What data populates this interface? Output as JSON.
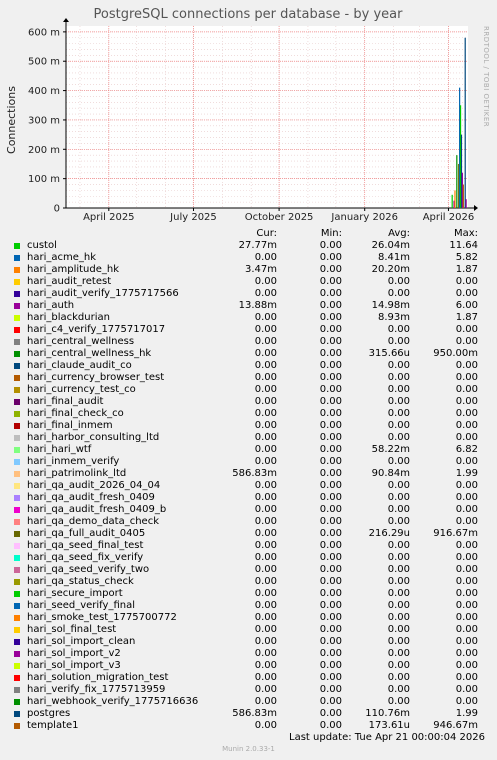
{
  "chart_data": {
    "type": "line",
    "title": "PostgreSQL connections per database - by year",
    "ylabel": "Connections",
    "watermark": "RRDTOOL / TOBI OETIKER",
    "ylim": [
      0,
      620
    ],
    "yticks": [
      {
        "v": 0,
        "label": "0"
      },
      {
        "v": 100,
        "label": "100 m"
      },
      {
        "v": 200,
        "label": "200 m"
      },
      {
        "v": 300,
        "label": "300 m"
      },
      {
        "v": 400,
        "label": "400 m"
      },
      {
        "v": 500,
        "label": "500 m"
      },
      {
        "v": 600,
        "label": "600 m"
      }
    ],
    "xrange": [
      "2025-02-14",
      "2026-04-22"
    ],
    "xticks": [
      {
        "date": "2025-04-01",
        "label": "April 2025"
      },
      {
        "date": "2025-07-01",
        "label": "July 2025"
      },
      {
        "date": "2025-10-01",
        "label": "October 2025"
      },
      {
        "date": "2026-01-01",
        "label": "January 2026"
      },
      {
        "date": "2026-04-01",
        "label": "April 2026"
      }
    ],
    "minor_gridlines": [
      "2025-03-01",
      "2025-04-01",
      "2025-05-01",
      "2025-06-01",
      "2025-07-01",
      "2025-08-01",
      "2025-09-01",
      "2025-10-01",
      "2025-11-01",
      "2025-12-01",
      "2026-01-01",
      "2026-02-01",
      "2026-03-01",
      "2026-04-01"
    ],
    "spikes": [
      {
        "series": "custol",
        "date": "2026-04-05",
        "value": 45
      },
      {
        "series": "hari_auth",
        "date": "2026-04-07",
        "value": 25
      },
      {
        "series": "hari_amplitude_hk",
        "date": "2026-04-08",
        "value": 60
      },
      {
        "series": "hari_central_wellness_hk",
        "date": "2026-04-10",
        "value": 180
      },
      {
        "series": "hari_qa_full_audit_0405",
        "date": "2026-04-12",
        "value": 150
      },
      {
        "series": "hari_acme_hk",
        "date": "2026-04-13",
        "value": 410
      },
      {
        "series": "custol",
        "date": "2026-04-14",
        "value": 350
      },
      {
        "series": "postgres",
        "date": "2026-04-15",
        "value": 250
      },
      {
        "series": "hari_auth",
        "date": "2026-04-16",
        "value": 120
      },
      {
        "series": "template1",
        "date": "2026-04-17",
        "value": 80
      },
      {
        "series": "postgres",
        "date": "2026-04-19",
        "value": 580
      },
      {
        "series": "hari_sol_import_v2",
        "date": "2026-04-20",
        "value": 30
      }
    ],
    "legend_headers": {
      "cur": "Cur:",
      "min": "Min:",
      "avg": "Avg:",
      "max": "Max:"
    },
    "series": [
      {
        "name": "custol",
        "color": "#00cc00",
        "cur": "27.77m",
        "min": "0.00",
        "avg": "26.04m",
        "max": "11.64"
      },
      {
        "name": "hari_acme_hk",
        "color": "#0066b3",
        "cur": "0.00",
        "min": "0.00",
        "avg": "8.41m",
        "max": "5.82"
      },
      {
        "name": "hari_amplitude_hk",
        "color": "#ff8000",
        "cur": "3.47m",
        "min": "0.00",
        "avg": "20.20m",
        "max": "1.87"
      },
      {
        "name": "hari_audit_retest",
        "color": "#ffcc00",
        "cur": "0.00",
        "min": "0.00",
        "avg": "0.00",
        "max": "0.00"
      },
      {
        "name": "hari_audit_verify_1775717566",
        "color": "#330099",
        "cur": "0.00",
        "min": "0.00",
        "avg": "0.00",
        "max": "0.00"
      },
      {
        "name": "hari_auth",
        "color": "#990099",
        "cur": "13.88m",
        "min": "0.00",
        "avg": "14.98m",
        "max": "6.00"
      },
      {
        "name": "hari_blackdurian",
        "color": "#ccff00",
        "cur": "0.00",
        "min": "0.00",
        "avg": "8.93m",
        "max": "1.87"
      },
      {
        "name": "hari_c4_verify_1775717017",
        "color": "#ff0000",
        "cur": "0.00",
        "min": "0.00",
        "avg": "0.00",
        "max": "0.00"
      },
      {
        "name": "hari_central_wellness",
        "color": "#808080",
        "cur": "0.00",
        "min": "0.00",
        "avg": "0.00",
        "max": "0.00"
      },
      {
        "name": "hari_central_wellness_hk",
        "color": "#008f00",
        "cur": "0.00",
        "min": "0.00",
        "avg": "315.66u",
        "max": "950.00m"
      },
      {
        "name": "hari_claude_audit_co",
        "color": "#00487d",
        "cur": "0.00",
        "min": "0.00",
        "avg": "0.00",
        "max": "0.00"
      },
      {
        "name": "hari_currency_browser_test",
        "color": "#b35a00",
        "cur": "0.00",
        "min": "0.00",
        "avg": "0.00",
        "max": "0.00"
      },
      {
        "name": "hari_currency_test_co",
        "color": "#b38f00",
        "cur": "0.00",
        "min": "0.00",
        "avg": "0.00",
        "max": "0.00"
      },
      {
        "name": "hari_final_audit",
        "color": "#6b006b",
        "cur": "0.00",
        "min": "0.00",
        "avg": "0.00",
        "max": "0.00"
      },
      {
        "name": "hari_final_check_co",
        "color": "#8fb300",
        "cur": "0.00",
        "min": "0.00",
        "avg": "0.00",
        "max": "0.00"
      },
      {
        "name": "hari_final_inmem",
        "color": "#b30000",
        "cur": "0.00",
        "min": "0.00",
        "avg": "0.00",
        "max": "0.00"
      },
      {
        "name": "hari_harbor_consulting_ltd",
        "color": "#bebebe",
        "cur": "0.00",
        "min": "0.00",
        "avg": "0.00",
        "max": "0.00"
      },
      {
        "name": "hari_hari_wtf",
        "color": "#80ff80",
        "cur": "0.00",
        "min": "0.00",
        "avg": "58.22m",
        "max": "6.82"
      },
      {
        "name": "hari_inmem_verify",
        "color": "#80c9ff",
        "cur": "0.00",
        "min": "0.00",
        "avg": "0.00",
        "max": "0.00"
      },
      {
        "name": "hari_patrimolink_ltd",
        "color": "#ffc080",
        "cur": "586.83m",
        "min": "0.00",
        "avg": "90.84m",
        "max": "1.99"
      },
      {
        "name": "hari_qa_audit_2026_04_04",
        "color": "#ffe680",
        "cur": "0.00",
        "min": "0.00",
        "avg": "0.00",
        "max": "0.00"
      },
      {
        "name": "hari_qa_audit_fresh_0409",
        "color": "#aa80ff",
        "cur": "0.00",
        "min": "0.00",
        "avg": "0.00",
        "max": "0.00"
      },
      {
        "name": "hari_qa_audit_fresh_0409_b",
        "color": "#ee00cc",
        "cur": "0.00",
        "min": "0.00",
        "avg": "0.00",
        "max": "0.00"
      },
      {
        "name": "hari_qa_demo_data_check",
        "color": "#ff8080",
        "cur": "0.00",
        "min": "0.00",
        "avg": "0.00",
        "max": "0.00"
      },
      {
        "name": "hari_qa_full_audit_0405",
        "color": "#666600",
        "cur": "0.00",
        "min": "0.00",
        "avg": "216.29u",
        "max": "916.67m"
      },
      {
        "name": "hari_qa_seed_final_test",
        "color": "#ffbfff",
        "cur": "0.00",
        "min": "0.00",
        "avg": "0.00",
        "max": "0.00"
      },
      {
        "name": "hari_qa_seed_fix_verify",
        "color": "#00ffcc",
        "cur": "0.00",
        "min": "0.00",
        "avg": "0.00",
        "max": "0.00"
      },
      {
        "name": "hari_qa_seed_verify_two",
        "color": "#cc6699",
        "cur": "0.00",
        "min": "0.00",
        "avg": "0.00",
        "max": "0.00"
      },
      {
        "name": "hari_qa_status_check",
        "color": "#999900",
        "cur": "0.00",
        "min": "0.00",
        "avg": "0.00",
        "max": "0.00"
      },
      {
        "name": "hari_secure_import",
        "color": "#00cc00",
        "cur": "0.00",
        "min": "0.00",
        "avg": "0.00",
        "max": "0.00"
      },
      {
        "name": "hari_seed_verify_final",
        "color": "#0066b3",
        "cur": "0.00",
        "min": "0.00",
        "avg": "0.00",
        "max": "0.00"
      },
      {
        "name": "hari_smoke_test_1775700772",
        "color": "#ff8000",
        "cur": "0.00",
        "min": "0.00",
        "avg": "0.00",
        "max": "0.00"
      },
      {
        "name": "hari_sol_final_test",
        "color": "#ffcc00",
        "cur": "0.00",
        "min": "0.00",
        "avg": "0.00",
        "max": "0.00"
      },
      {
        "name": "hari_sol_import_clean",
        "color": "#330099",
        "cur": "0.00",
        "min": "0.00",
        "avg": "0.00",
        "max": "0.00"
      },
      {
        "name": "hari_sol_import_v2",
        "color": "#990099",
        "cur": "0.00",
        "min": "0.00",
        "avg": "0.00",
        "max": "0.00"
      },
      {
        "name": "hari_sol_import_v3",
        "color": "#ccff00",
        "cur": "0.00",
        "min": "0.00",
        "avg": "0.00",
        "max": "0.00"
      },
      {
        "name": "hari_solution_migration_test",
        "color": "#ff0000",
        "cur": "0.00",
        "min": "0.00",
        "avg": "0.00",
        "max": "0.00"
      },
      {
        "name": "hari_verify_fix_1775713959",
        "color": "#808080",
        "cur": "0.00",
        "min": "0.00",
        "avg": "0.00",
        "max": "0.00"
      },
      {
        "name": "hari_webhook_verify_1775716636",
        "color": "#008f00",
        "cur": "0.00",
        "min": "0.00",
        "avg": "0.00",
        "max": "0.00"
      },
      {
        "name": "postgres",
        "color": "#00487d",
        "cur": "586.83m",
        "min": "0.00",
        "avg": "110.76m",
        "max": "1.99"
      },
      {
        "name": "template1",
        "color": "#b35a00",
        "cur": "0.00",
        "min": "0.00",
        "avg": "173.61u",
        "max": "946.67m"
      }
    ]
  },
  "last_update": "Last update:  Tue Apr 21 00:00:04 2026",
  "footer": "Munin 2.0.33-1"
}
